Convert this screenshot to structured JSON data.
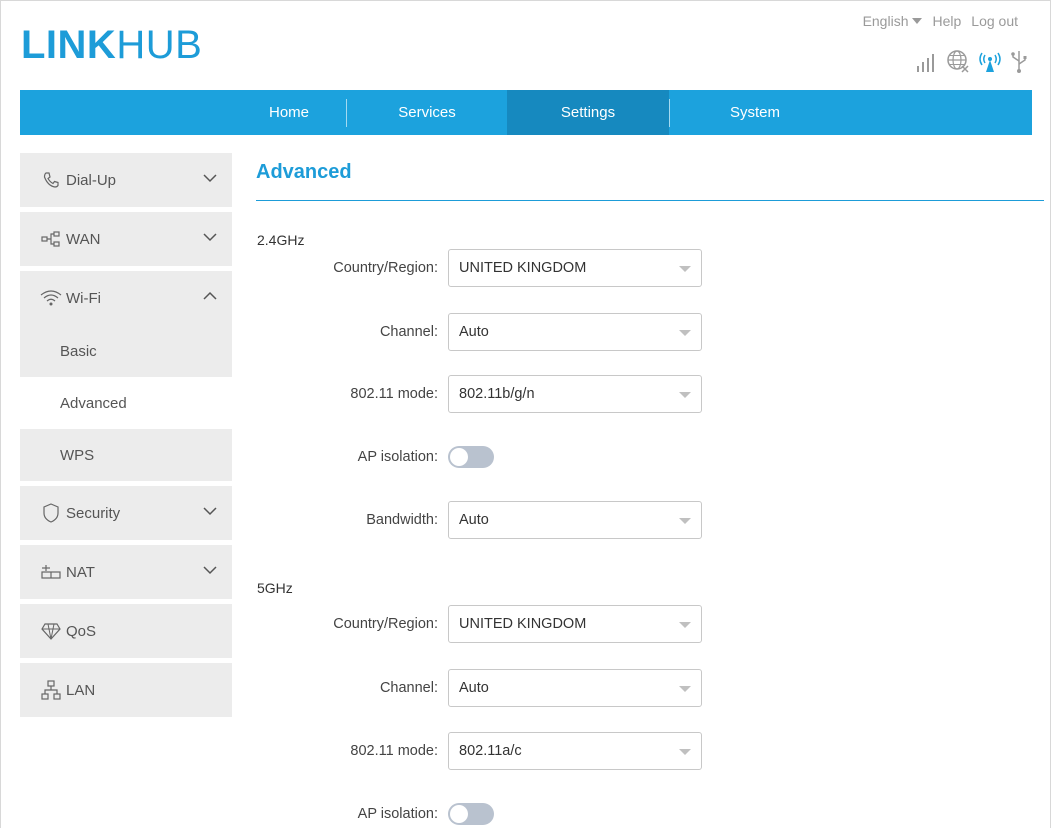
{
  "brand": {
    "bold": "LINK",
    "light": "HUB"
  },
  "toplinks": {
    "language": "English",
    "help": "Help",
    "logout": "Log out"
  },
  "status_icons": [
    "signal-icon",
    "globe-icon",
    "wifi-broadcast-icon",
    "usb-icon"
  ],
  "nav": [
    {
      "label": "Home",
      "active": false
    },
    {
      "label": "Services",
      "active": false
    },
    {
      "label": "Settings",
      "active": true
    },
    {
      "label": "System",
      "active": false
    }
  ],
  "sidebar": {
    "dialup": "Dial-Up",
    "wan": "WAN",
    "wifi": "Wi-Fi",
    "wifi_sub": [
      "Basic",
      "Advanced",
      "WPS"
    ],
    "security": "Security",
    "nat": "NAT",
    "qos": "QoS",
    "lan": "LAN"
  },
  "main": {
    "title": "Advanced",
    "band24": {
      "label": "2.4GHz",
      "country_label": "Country/Region:",
      "country_value": "UNITED KINGDOM",
      "channel_label": "Channel:",
      "channel_value": "Auto",
      "mode_label": "802.11 mode:",
      "mode_value": "802.11b/g/n",
      "ap_label": "AP isolation:",
      "ap_on": false,
      "bandwidth_label": "Bandwidth:",
      "bandwidth_value": "Auto"
    },
    "band5": {
      "label": "5GHz",
      "country_label": "Country/Region:",
      "country_value": "UNITED KINGDOM",
      "channel_label": "Channel:",
      "channel_value": "Auto",
      "mode_label": "802.11 mode:",
      "mode_value": "802.11a/c",
      "ap_label": "AP isolation:",
      "ap_on": false
    }
  },
  "colors": {
    "accent": "#1ca2dd",
    "nav_active": "#1689bf",
    "sidebar_bg": "#ececec",
    "toggle_off": "#b9c2cf"
  }
}
